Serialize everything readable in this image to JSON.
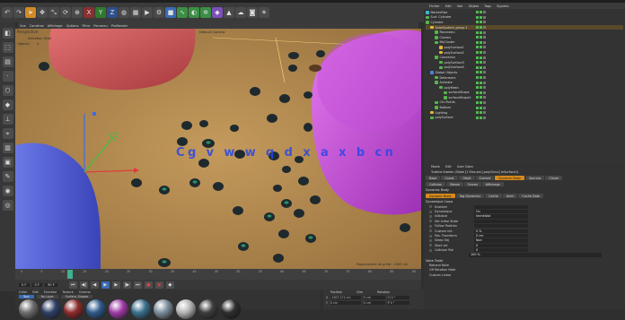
{
  "menus": [
    "Vue",
    "Caméras",
    "Affichage",
    "Options",
    "Filtre",
    "Panneau",
    "ProRender"
  ],
  "toolbar": {
    "icons": [
      "undo-icon",
      "redo-icon",
      "select-icon",
      "move-icon",
      "scale-icon",
      "rotate-icon",
      "recent-icon",
      "x-axis-icon",
      "y-axis-icon",
      "z-axis-icon",
      "world-icon",
      "render-region-icon",
      "render-view-icon",
      "render-settings-icon",
      "cube-icon",
      "spline-icon",
      "nurbs-icon",
      "array-icon",
      "deformer-icon",
      "scene-icon",
      "environment-icon",
      "camera-icon",
      "light-icon"
    ],
    "axis_labels": [
      "X",
      "Y",
      "Z"
    ],
    "colors": {
      "blue": "#4b83d6",
      "green": "#56b64a",
      "red": "#c94a3f",
      "yellow": "#e2b43b",
      "purple": "#9b6bd6",
      "cyan": "#3fb6c6"
    }
  },
  "viewport": {
    "label": "Perspective",
    "sublabel": "Selection Total",
    "objects_label": "Objects",
    "objects_count": "4",
    "camera_label": "Default Camera",
    "grid_label": "Espacement de grille : 1000 cm",
    "watermark": "Cg   v   w   w   q d x a x   b   cn"
  },
  "timeline": {
    "ticks": [
      "0",
      "5",
      "10",
      "15",
      "20",
      "25",
      "30",
      "35",
      "40",
      "45",
      "50",
      "55",
      "60",
      "65",
      "70",
      "75",
      "80",
      "85",
      "90"
    ],
    "current_frame": "0 F",
    "end_frame": "90 F",
    "start_frame": "0 F"
  },
  "transport_buttons": [
    "go-start-icon",
    "prev-key-icon",
    "prev-frame-icon",
    "play-icon",
    "next-frame-icon",
    "next-key-icon",
    "go-end-icon",
    "record-icon",
    "autokey-icon",
    "keyframe-icon"
  ],
  "materials": {
    "menu": [
      "Créer",
      "Edit",
      "Fonction",
      "Texture",
      "Cinema"
    ],
    "filters": [
      "Tout",
      "No Layer",
      "Surface_Shapes"
    ],
    "balls": [
      "#6d6d6d",
      "#2f3f66",
      "#8b2b2b",
      "#2e5a8a",
      "#a03ca8",
      "#3b6f8d",
      "#7c8c9a",
      "#b5b5b5",
      "#3d3d3d",
      "#2e2e2e"
    ]
  },
  "coords": {
    "headers": [
      "Position",
      "Dim",
      "Rotation"
    ],
    "rows": [
      {
        "axis": "X",
        "pos": "-1307.171 cm",
        "dim": "0 cm",
        "rot": "H 0 °"
      },
      {
        "axis": "Y",
        "pos": "0 cm",
        "dim": "0 cm",
        "rot": "P 0 °"
      }
    ]
  },
  "object_manager": {
    "menu": [
      "Fichier",
      "Edit",
      "Voir",
      "Objets",
      "Tags",
      "Signets"
    ],
    "rows": [
      {
        "label": "MarkerRise",
        "indent": 0,
        "color": "#3fb6c6"
      },
      {
        "label": "Surf. Cylindre",
        "indent": 0,
        "color": "#56b64a"
      },
      {
        "label": "Cylindre",
        "indent": 0,
        "color": "#56b64a"
      },
      {
        "label": "SolarSystem_group.1",
        "indent": 1,
        "color": "#e2b43b"
      },
      {
        "label": "Reconstru",
        "indent": 2,
        "color": "#56b64a"
      },
      {
        "label": "Cloners",
        "indent": 2,
        "color": "#56b64a"
      },
      {
        "label": "MoCluster",
        "indent": 2,
        "color": "#56b64a"
      },
      {
        "label": "polySurface1",
        "indent": 3,
        "color": "#e2b43b"
      },
      {
        "label": "polySurface2",
        "indent": 3,
        "color": "#e2b43b"
      },
      {
        "label": "Connector",
        "indent": 2,
        "color": "#56b64a"
      },
      {
        "label": "polySurface3",
        "indent": 3,
        "color": "#56b64a"
      },
      {
        "label": "polySurface4",
        "indent": 3,
        "color": "#56b64a"
      },
      {
        "label": "Global Objects",
        "indent": 1,
        "color": "#4b83d6"
      },
      {
        "label": "Deformers",
        "indent": 2,
        "color": "#56b64a"
      },
      {
        "label": "Animate",
        "indent": 2,
        "color": "#56b64a"
      },
      {
        "label": "polyMesh",
        "indent": 3,
        "color": "#56b64a"
      },
      {
        "label": "surfaceShape",
        "indent": 4,
        "color": "#56b64a"
      },
      {
        "label": "surfaceShape1",
        "indent": 4,
        "color": "#56b64a"
      },
      {
        "label": "Ctrl.Points",
        "indent": 2,
        "color": "#56b64a"
      },
      {
        "label": "Bottom",
        "indent": 2,
        "color": "#56b64a"
      },
      {
        "label": "Lighting",
        "indent": 1,
        "color": "#e2b43b"
      },
      {
        "label": "polySurface",
        "indent": 1,
        "color": "#56b64a"
      }
    ]
  },
  "attributes": {
    "menu": [
      "Mode",
      "Edit",
      "User Data"
    ],
    "object_title": "Turbine Kraken (Objet [1 Etra.sec] polyCircul] mSurface1)",
    "tabs_row1": [
      "Base",
      "Coord.",
      "Objet",
      "Suivant",
      "Dynamic Body",
      "Sources",
      "Cloner"
    ],
    "tabs_row2": [
      "Collision",
      "Masse",
      "Forces",
      "Affichage"
    ],
    "section": "Dynamic Body",
    "subtabs": [
      "Dynamic Body",
      "Tag Dynamics",
      "Cache",
      "Anim",
      "Cache Data"
    ],
    "subsection": "Dynamique Corps",
    "fields": [
      {
        "label": "Enabled",
        "value": ""
      },
      {
        "label": "Dynamique",
        "value": "On"
      },
      {
        "label": "Initialize",
        "value": "Immédiat"
      },
      {
        "label": "Set Initial State",
        "value": ""
      },
      {
        "label": "Follow Position",
        "value": ""
      },
      {
        "label": "Custom Init.",
        "value": "0 %"
      },
      {
        "label": "Pos. Transform",
        "value": "0 cm"
      },
      {
        "label": "Sleep Obj",
        "value": "Non"
      },
      {
        "label": "Start vel",
        "value": "0"
      },
      {
        "label": "Collision Rot",
        "value": "0"
      }
    ],
    "trigger_value": "100 %",
    "footer_section": "Votre Traite",
    "footer_fields": [
      "Rebond Note",
      "Off Rotation Note",
      "Custom Linear"
    ]
  }
}
